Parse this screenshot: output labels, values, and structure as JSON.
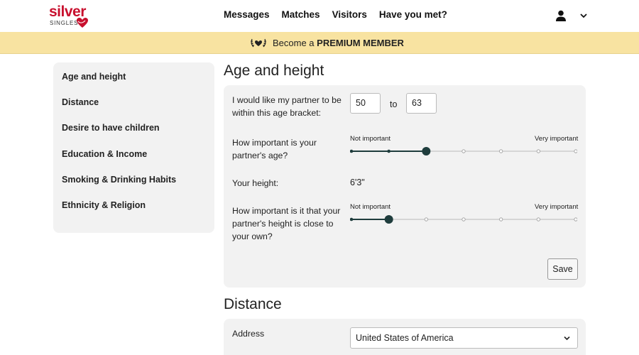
{
  "brand": {
    "name": "silver",
    "sub": "SINGLES",
    "color": "#c8102e"
  },
  "nav": [
    "Messages",
    "Matches",
    "Visitors",
    "Have you met?"
  ],
  "header_icons": {
    "user": "user-icon",
    "menu": "chevron-down-icon"
  },
  "banner": {
    "prefix": "Become a",
    "bold": "PREMIUM MEMBER",
    "icon": "laurel-heart-icon",
    "bg": "#f8e3a1"
  },
  "sidebar": {
    "items": [
      {
        "label": "Age and height"
      },
      {
        "label": "Distance"
      },
      {
        "label": "Desire to have children"
      },
      {
        "label": "Education & Income"
      },
      {
        "label": "Smoking & Drinking Habits"
      },
      {
        "label": "Ethnicity & Religion"
      }
    ]
  },
  "age_height": {
    "title": "Age and height",
    "age_label": "I would like my partner to be within this age bracket:",
    "age_min": "50",
    "age_to": "to",
    "age_max": "63",
    "age_importance_label": "How important is your partner's age?",
    "scale_low": "Not important",
    "scale_high": "Very important",
    "age_importance": {
      "value": 3,
      "steps": 7
    },
    "height_label": "Your height:",
    "height_value": "6'3\"",
    "height_importance_label": "How important is it that your partner's height is close to your own?",
    "height_importance": {
      "value": 2,
      "steps": 7
    },
    "save": "Save"
  },
  "distance": {
    "title": "Distance",
    "address_label": "Address",
    "address_value": "United States of America"
  },
  "colors": {
    "slider_dark": "#1f3d3d",
    "slider_track": "#bbbbbb"
  }
}
